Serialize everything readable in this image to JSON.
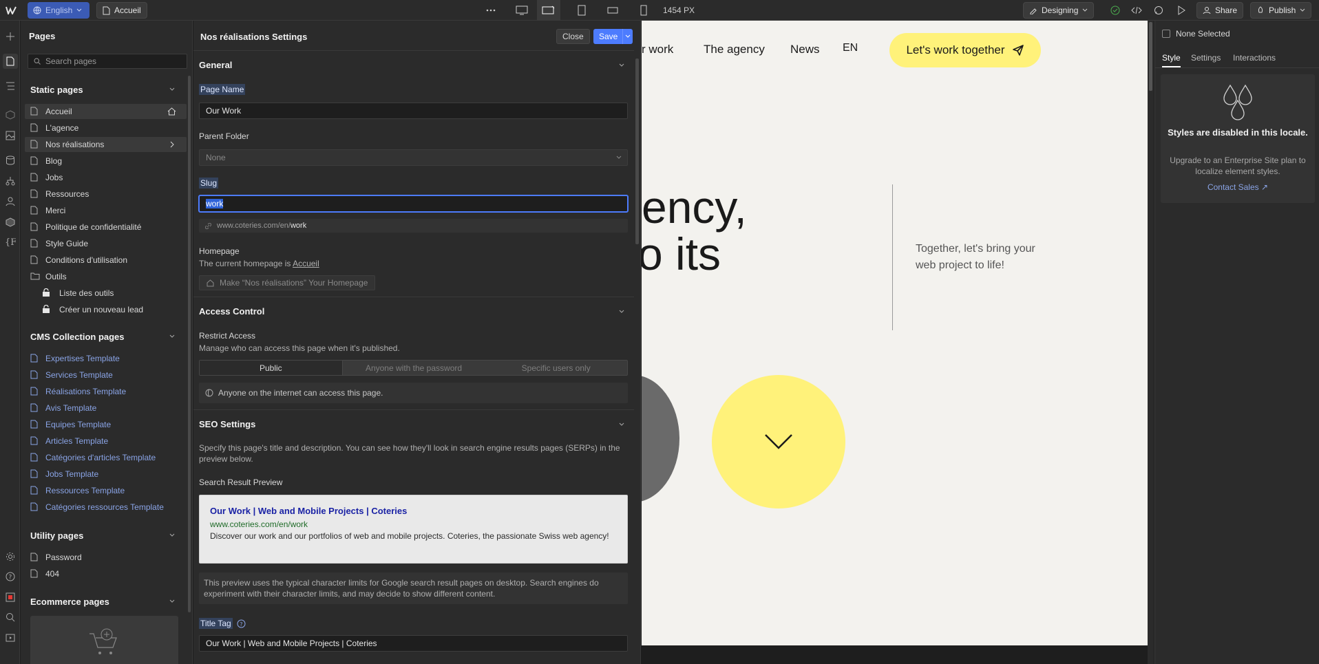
{
  "topbar": {
    "language": "English",
    "page": "Accueil",
    "width_readout": "1454 PX",
    "mode": "Designing",
    "share": "Share",
    "publish": "Publish"
  },
  "pages_panel": {
    "title": "Pages",
    "search_placeholder": "Search pages",
    "static_title": "Static pages",
    "static_pages": [
      "Accueil",
      "L'agence",
      "Nos réalisations",
      "Blog",
      "Jobs",
      "Ressources",
      "Merci",
      "Politique de confidentialité",
      "Style Guide",
      "Conditions d'utilisation",
      "Outils",
      "Liste des outils",
      "Créer un nouveau lead"
    ],
    "cms_title": "CMS Collection pages",
    "cms_pages": [
      "Expertises Template",
      "Services Template",
      "Réalisations Template",
      "Avis Template",
      "Equipes Template",
      "Articles Template",
      "Catégories d'articles Template",
      "Jobs Template",
      "Ressources Template",
      "Catégories ressources Template"
    ],
    "utility_title": "Utility pages",
    "utility_pages": [
      "Password",
      "404"
    ],
    "ecommerce_title": "Ecommerce pages"
  },
  "settings": {
    "title": "Nos réalisations Settings",
    "close": "Close",
    "save": "Save",
    "general": "General",
    "page_name_label": "Page Name",
    "page_name_value": "Our Work",
    "parent_folder_label": "Parent Folder",
    "parent_folder_value": "None",
    "slug_label": "Slug",
    "slug_value": "work",
    "url_prefix": "www.coteries.com/en/",
    "url_slug": "work",
    "homepage_label": "Homepage",
    "homepage_text": "The current homepage is ",
    "homepage_link": "Accueil",
    "make_homepage": "Make “Nos réalisations” Your Homepage",
    "access_title": "Access Control",
    "restrict_label": "Restrict Access",
    "restrict_desc": "Manage who can access this page when it's published.",
    "access_options": [
      "Public",
      "Anyone with the password",
      "Specific users only"
    ],
    "access_note": "Anyone on the internet can access this page.",
    "seo_title": "SEO Settings",
    "seo_desc": "Specify this page's title and description. You can see how they'll look in search engine results pages (SERPs) in the preview below.",
    "preview_label": "Search Result Preview",
    "preview_title": "Our Work | Web and Mobile Projects | Coteries",
    "preview_url": "www.coteries.com/en/work",
    "preview_desc": "Discover our work and our portfolios of web and mobile projects. Coteries, the passionate Swiss web agency!",
    "preview_note": "This preview uses the typical character limits for Google search result pages on desktop. Search engines do experiment with their character limits, and may decide to show different content.",
    "title_tag_label": "Title Tag",
    "title_tag_value": "Our Work | Web and Mobile Projects | Coteries"
  },
  "canvas": {
    "nav": [
      "r work",
      "The agency",
      "News",
      "EN"
    ],
    "cta": "Let's work together",
    "headline_1": "ency,",
    "headline_2": "o its",
    "side_text": "Together, let's bring your web project to life!"
  },
  "right_panel": {
    "none_selected": "None Selected",
    "tabs": [
      "Style",
      "Settings",
      "Interactions"
    ],
    "disabled_title": "Styles are disabled in this locale.",
    "disabled_desc": "Upgrade to an Enterprise Site plan to localize element styles.",
    "contact": "Contact Sales ↗"
  },
  "colors": {
    "accent_blue": "#4d7cfe",
    "canvas_bg": "#f3f2ee",
    "cta_yellow": "#fff27a"
  }
}
